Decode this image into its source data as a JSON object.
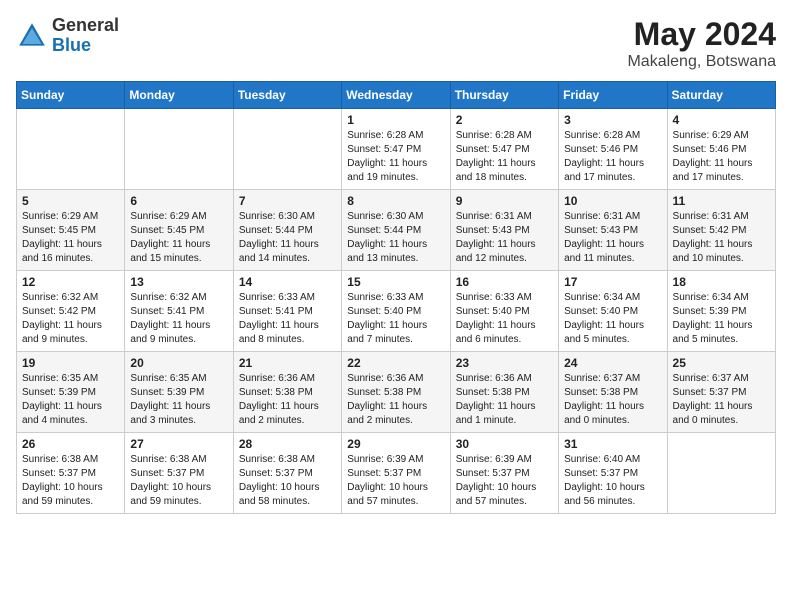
{
  "logo": {
    "text_general": "General",
    "text_blue": "Blue"
  },
  "title": "May 2024",
  "subtitle": "Makaleng, Botswana",
  "days_header": [
    "Sunday",
    "Monday",
    "Tuesday",
    "Wednesday",
    "Thursday",
    "Friday",
    "Saturday"
  ],
  "weeks": [
    [
      {
        "day": "",
        "info": ""
      },
      {
        "day": "",
        "info": ""
      },
      {
        "day": "",
        "info": ""
      },
      {
        "day": "1",
        "info": "Sunrise: 6:28 AM\nSunset: 5:47 PM\nDaylight: 11 hours and 19 minutes."
      },
      {
        "day": "2",
        "info": "Sunrise: 6:28 AM\nSunset: 5:47 PM\nDaylight: 11 hours and 18 minutes."
      },
      {
        "day": "3",
        "info": "Sunrise: 6:28 AM\nSunset: 5:46 PM\nDaylight: 11 hours and 17 minutes."
      },
      {
        "day": "4",
        "info": "Sunrise: 6:29 AM\nSunset: 5:46 PM\nDaylight: 11 hours and 17 minutes."
      }
    ],
    [
      {
        "day": "5",
        "info": "Sunrise: 6:29 AM\nSunset: 5:45 PM\nDaylight: 11 hours and 16 minutes."
      },
      {
        "day": "6",
        "info": "Sunrise: 6:29 AM\nSunset: 5:45 PM\nDaylight: 11 hours and 15 minutes."
      },
      {
        "day": "7",
        "info": "Sunrise: 6:30 AM\nSunset: 5:44 PM\nDaylight: 11 hours and 14 minutes."
      },
      {
        "day": "8",
        "info": "Sunrise: 6:30 AM\nSunset: 5:44 PM\nDaylight: 11 hours and 13 minutes."
      },
      {
        "day": "9",
        "info": "Sunrise: 6:31 AM\nSunset: 5:43 PM\nDaylight: 11 hours and 12 minutes."
      },
      {
        "day": "10",
        "info": "Sunrise: 6:31 AM\nSunset: 5:43 PM\nDaylight: 11 hours and 11 minutes."
      },
      {
        "day": "11",
        "info": "Sunrise: 6:31 AM\nSunset: 5:42 PM\nDaylight: 11 hours and 10 minutes."
      }
    ],
    [
      {
        "day": "12",
        "info": "Sunrise: 6:32 AM\nSunset: 5:42 PM\nDaylight: 11 hours and 9 minutes."
      },
      {
        "day": "13",
        "info": "Sunrise: 6:32 AM\nSunset: 5:41 PM\nDaylight: 11 hours and 9 minutes."
      },
      {
        "day": "14",
        "info": "Sunrise: 6:33 AM\nSunset: 5:41 PM\nDaylight: 11 hours and 8 minutes."
      },
      {
        "day": "15",
        "info": "Sunrise: 6:33 AM\nSunset: 5:40 PM\nDaylight: 11 hours and 7 minutes."
      },
      {
        "day": "16",
        "info": "Sunrise: 6:33 AM\nSunset: 5:40 PM\nDaylight: 11 hours and 6 minutes."
      },
      {
        "day": "17",
        "info": "Sunrise: 6:34 AM\nSunset: 5:40 PM\nDaylight: 11 hours and 5 minutes."
      },
      {
        "day": "18",
        "info": "Sunrise: 6:34 AM\nSunset: 5:39 PM\nDaylight: 11 hours and 5 minutes."
      }
    ],
    [
      {
        "day": "19",
        "info": "Sunrise: 6:35 AM\nSunset: 5:39 PM\nDaylight: 11 hours and 4 minutes."
      },
      {
        "day": "20",
        "info": "Sunrise: 6:35 AM\nSunset: 5:39 PM\nDaylight: 11 hours and 3 minutes."
      },
      {
        "day": "21",
        "info": "Sunrise: 6:36 AM\nSunset: 5:38 PM\nDaylight: 11 hours and 2 minutes."
      },
      {
        "day": "22",
        "info": "Sunrise: 6:36 AM\nSunset: 5:38 PM\nDaylight: 11 hours and 2 minutes."
      },
      {
        "day": "23",
        "info": "Sunrise: 6:36 AM\nSunset: 5:38 PM\nDaylight: 11 hours and 1 minute."
      },
      {
        "day": "24",
        "info": "Sunrise: 6:37 AM\nSunset: 5:38 PM\nDaylight: 11 hours and 0 minutes."
      },
      {
        "day": "25",
        "info": "Sunrise: 6:37 AM\nSunset: 5:37 PM\nDaylight: 11 hours and 0 minutes."
      }
    ],
    [
      {
        "day": "26",
        "info": "Sunrise: 6:38 AM\nSunset: 5:37 PM\nDaylight: 10 hours and 59 minutes."
      },
      {
        "day": "27",
        "info": "Sunrise: 6:38 AM\nSunset: 5:37 PM\nDaylight: 10 hours and 59 minutes."
      },
      {
        "day": "28",
        "info": "Sunrise: 6:38 AM\nSunset: 5:37 PM\nDaylight: 10 hours and 58 minutes."
      },
      {
        "day": "29",
        "info": "Sunrise: 6:39 AM\nSunset: 5:37 PM\nDaylight: 10 hours and 57 minutes."
      },
      {
        "day": "30",
        "info": "Sunrise: 6:39 AM\nSunset: 5:37 PM\nDaylight: 10 hours and 57 minutes."
      },
      {
        "day": "31",
        "info": "Sunrise: 6:40 AM\nSunset: 5:37 PM\nDaylight: 10 hours and 56 minutes."
      },
      {
        "day": "",
        "info": ""
      }
    ]
  ]
}
